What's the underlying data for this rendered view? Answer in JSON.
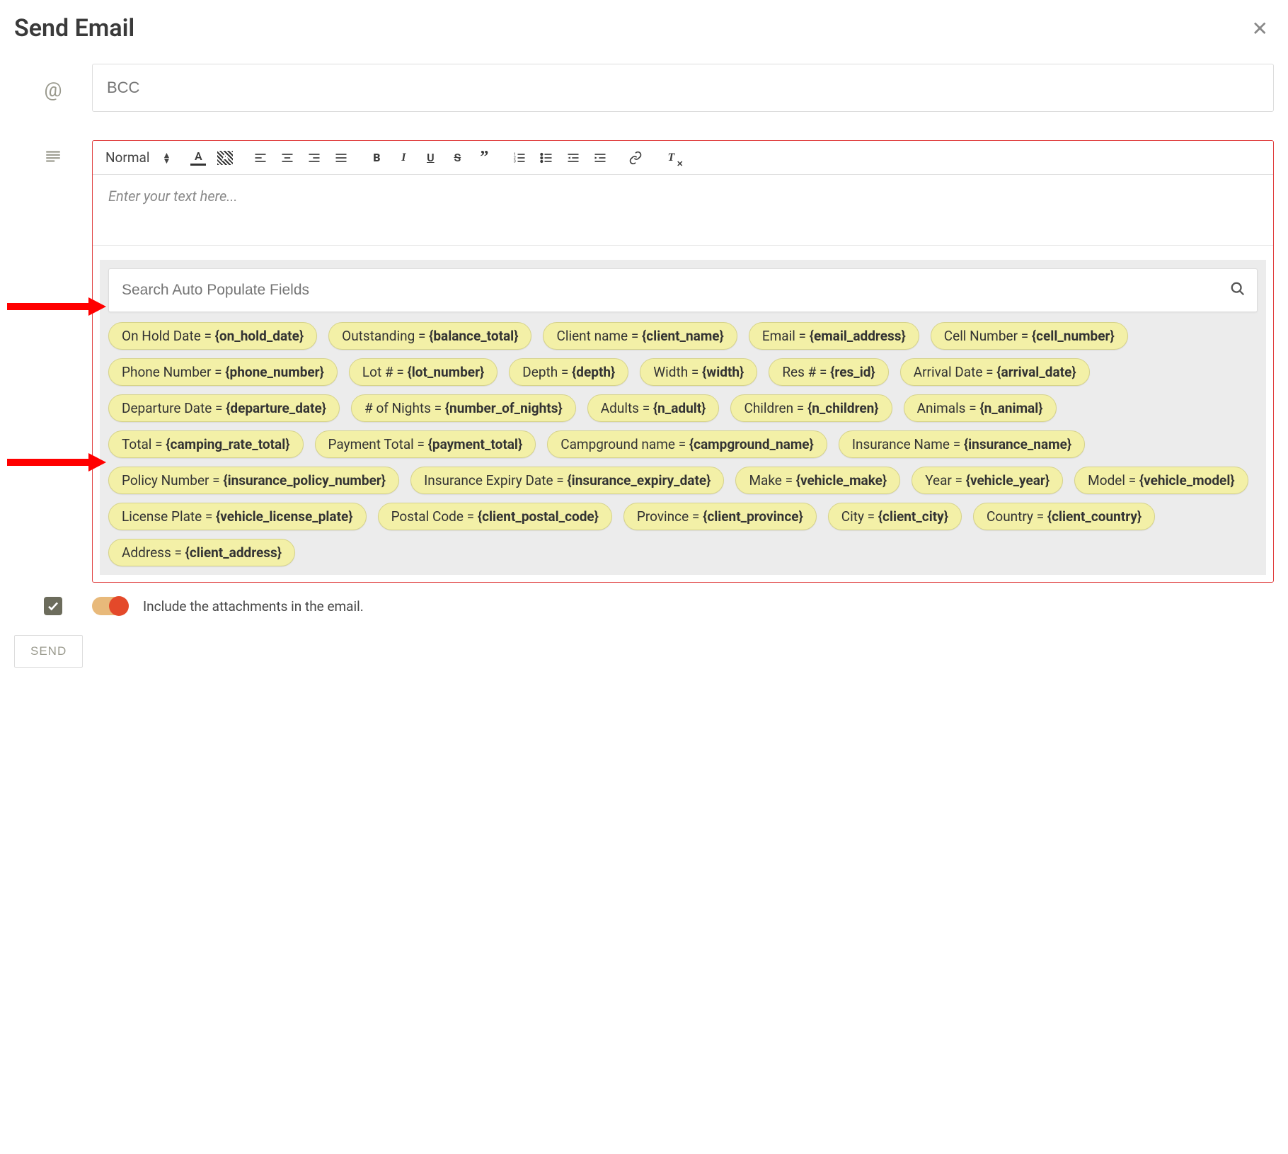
{
  "title": "Send Email",
  "bcc_placeholder": "BCC",
  "toolbar": {
    "normal_label": "Normal"
  },
  "editor_placeholder": "Enter your text here...",
  "search_placeholder": "Search Auto Populate Fields",
  "pills": [
    {
      "label": "On Hold Date",
      "var": "{on_hold_date}"
    },
    {
      "label": "Outstanding",
      "var": "{balance_total}"
    },
    {
      "label": "Client name",
      "var": "{client_name}"
    },
    {
      "label": "Email",
      "var": "{email_address}"
    },
    {
      "label": "Cell Number",
      "var": "{cell_number}"
    },
    {
      "label": "Phone Number",
      "var": "{phone_number}"
    },
    {
      "label": "Lot #",
      "var": "{lot_number}"
    },
    {
      "label": "Depth",
      "var": "{depth}"
    },
    {
      "label": "Width",
      "var": "{width}"
    },
    {
      "label": "Res #",
      "var": "{res_id}"
    },
    {
      "label": "Arrival Date",
      "var": "{arrival_date}"
    },
    {
      "label": "Departure Date",
      "var": "{departure_date}"
    },
    {
      "label": "# of Nights",
      "var": "{number_of_nights}"
    },
    {
      "label": "Adults",
      "var": "{n_adult}"
    },
    {
      "label": "Children",
      "var": "{n_children}"
    },
    {
      "label": "Animals",
      "var": "{n_animal}"
    },
    {
      "label": "Total",
      "var": "{camping_rate_total}"
    },
    {
      "label": "Payment Total",
      "var": "{payment_total}"
    },
    {
      "label": "Campground name",
      "var": "{campground_name}"
    },
    {
      "label": "Insurance Name",
      "var": "{insurance_name}"
    },
    {
      "label": "Policy Number",
      "var": "{insurance_policy_number}"
    },
    {
      "label": "Insurance Expiry Date",
      "var": "{insurance_expiry_date}"
    },
    {
      "label": "Make",
      "var": "{vehicle_make}"
    },
    {
      "label": "Year",
      "var": "{vehicle_year}"
    },
    {
      "label": "Model",
      "var": "{vehicle_model}"
    },
    {
      "label": "License Plate",
      "var": "{vehicle_license_plate}"
    },
    {
      "label": "Postal Code",
      "var": "{client_postal_code}"
    },
    {
      "label": "Province",
      "var": "{client_province}"
    },
    {
      "label": "City",
      "var": "{client_city}"
    },
    {
      "label": "Country",
      "var": "{client_country}"
    },
    {
      "label": "Address",
      "var": "{client_address}"
    }
  ],
  "attachments_label": "Include the attachments in the email.",
  "send_label": "SEND"
}
